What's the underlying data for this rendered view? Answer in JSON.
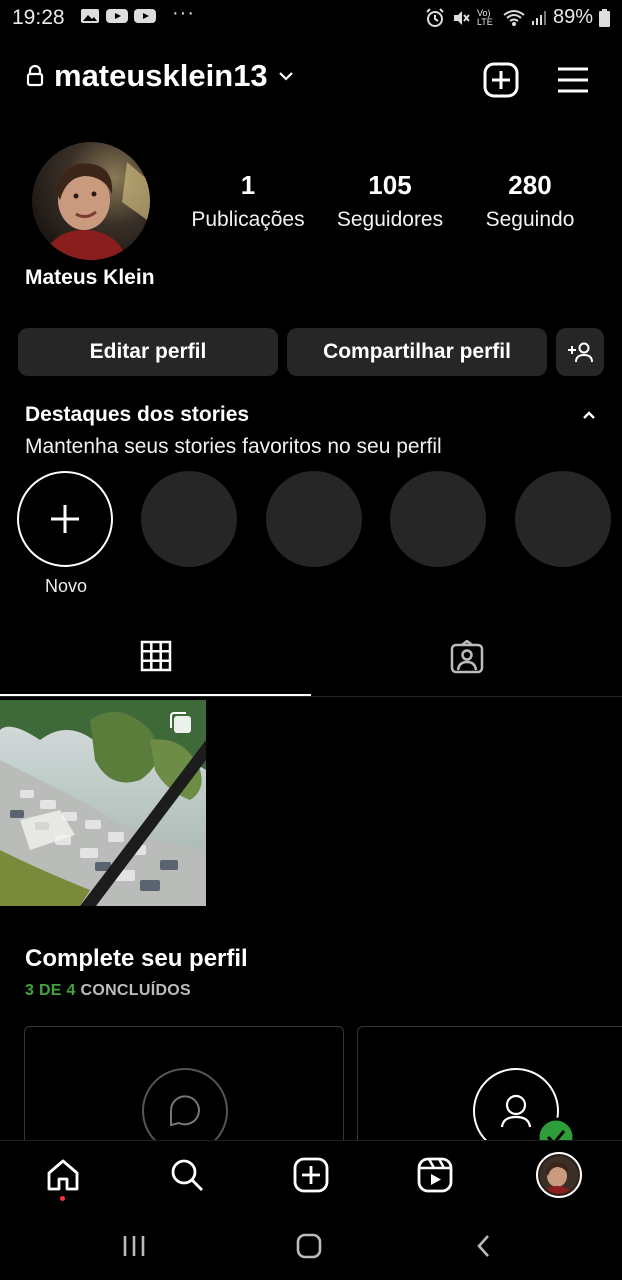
{
  "status_bar": {
    "time": "19:28",
    "dots": "···",
    "battery": "89%",
    "network_label": "Vo) LTE"
  },
  "header": {
    "username": "mateusklein13",
    "icons": [
      "lock-icon",
      "chevron-down-icon",
      "add-post-icon",
      "menu-icon"
    ]
  },
  "profile": {
    "name": "Mateus Klein",
    "stats": [
      {
        "value": "1",
        "label": "Publicações"
      },
      {
        "value": "105",
        "label": "Seguidores"
      },
      {
        "value": "280",
        "label": "Seguindo"
      }
    ]
  },
  "actions": {
    "edit": "Editar perfil",
    "share": "Compartilhar perfil",
    "discover_people_icon": "add-person-icon"
  },
  "highlights": {
    "title": "Destaques dos stories",
    "subtitle": "Mantenha seus stories favoritos no seu perfil",
    "new_label": "Novo",
    "placeholders": 4
  },
  "tabs": [
    {
      "name": "grid",
      "icon": "grid-icon",
      "active": true
    },
    {
      "name": "tagged",
      "icon": "tagged-icon",
      "active": false
    }
  ],
  "posts": [
    {
      "type": "carousel",
      "icon": "multiple-photos-icon"
    }
  ],
  "complete_profile": {
    "title": "Complete seu perfil",
    "progress_done": "3 DE 4",
    "progress_suffix": "CONCLUÍDOS",
    "cards": [
      {
        "icon": "speech-bubble-icon"
      },
      {
        "icon": "person-icon",
        "done": true
      }
    ]
  },
  "colors": {
    "background": "#000000",
    "button": "#262626",
    "progress_green": "#45a340",
    "notification_dot": "#ff3040",
    "check_green": "#2e9e3a"
  },
  "bottom_nav": [
    "home-icon",
    "search-icon",
    "create-icon",
    "reels-icon",
    "profile-avatar"
  ],
  "system_nav": [
    "recents-icon",
    "home-button-icon",
    "back-icon"
  ]
}
